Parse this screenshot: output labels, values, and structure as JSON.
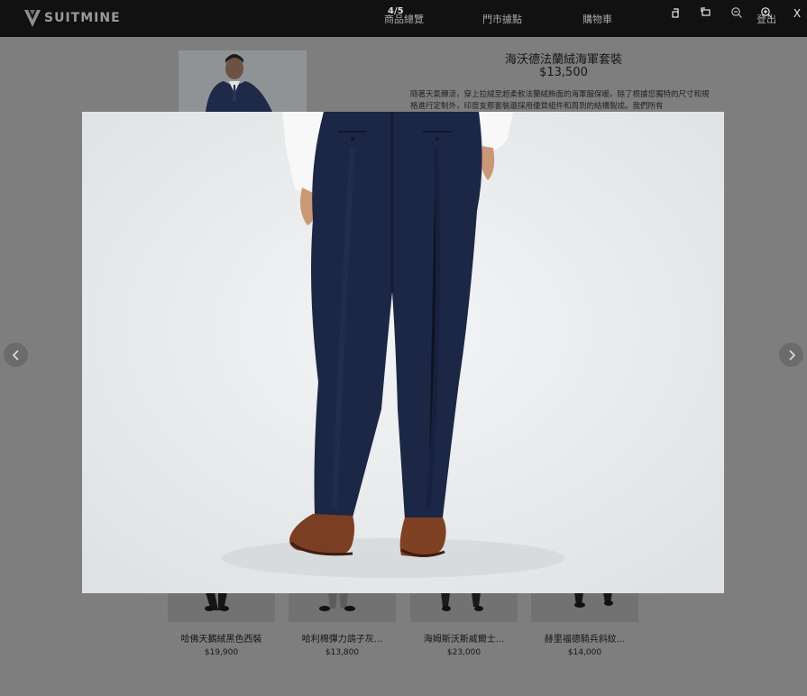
{
  "brand": {
    "name": "SUITMINE"
  },
  "nav": {
    "items": [
      "商品總覽",
      "門市據點",
      "購物車"
    ],
    "logout": "登出"
  },
  "lightbox": {
    "counter": "4/5",
    "close": "X"
  },
  "product": {
    "title": "海沃德法蘭絨海軍套裝",
    "price": "$13,500",
    "description": "隨著天氣轉涼，穿上拉絨至超柔軟法蘭絨飾面的海軍服保暖。除了根據您獨特的尺寸和規格進行定制外，印度支那套裝還採用優質組件和周到的結構製成。我們所有"
  },
  "related": [
    {
      "name": "哈佛天鵝絨黑色西裝",
      "price": "$19,900"
    },
    {
      "name": "哈利棉彈力鴿子灰...",
      "price": "$13,800"
    },
    {
      "name": "海姆斯沃斯威爾士...",
      "price": "$23,000"
    },
    {
      "name": "赫里福德騎兵斜紋...",
      "price": "$14,000"
    }
  ],
  "colors": {
    "navy_suit": "#1c2745",
    "topbar": "#111111",
    "overlay": "#7e7e7e"
  },
  "icons": [
    "prev-arrow-icon",
    "next-arrow-icon",
    "zoom-out-icon",
    "zoom-in-icon",
    "close-icon",
    "rotate-icon",
    "fullscreen-icon"
  ]
}
